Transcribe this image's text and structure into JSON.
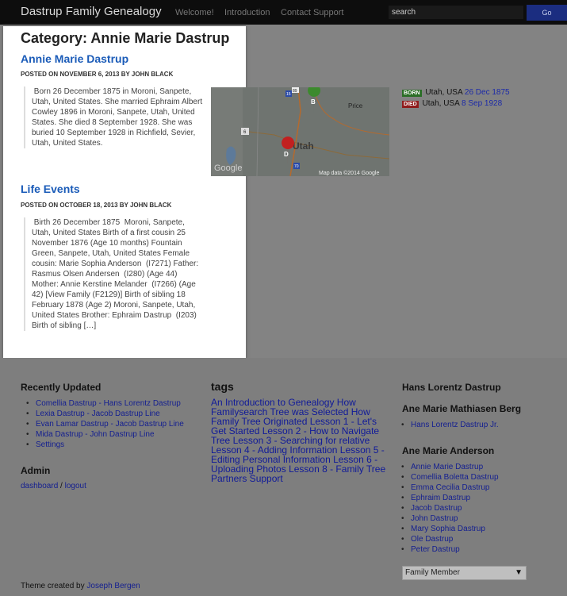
{
  "header": {
    "site_title": "Dastrup Family Genealogy",
    "nav": [
      "Welcome!",
      "Introduction",
      "Contact Support"
    ],
    "search_placeholder": "search",
    "go_label": "Go"
  },
  "main": {
    "category_title": "Category: Annie Marie Dastrup",
    "posts": [
      {
        "title": "Annie Marie Dastrup",
        "meta": "POSTED ON NOVEMBER 6, 2013 BY JOHN BLACK",
        "body": " Born 26 December 1875 in Moroni, Sanpete, Utah, United States. She married Ephraim Albert Cowley 1896 in Moroni, Sanpete, Utah, United States. She died 8 September 1928. She was buried 10 September 1928 in Richfield, Sevier, Utah, United States."
      },
      {
        "title": "Life Events",
        "meta": "POSTED ON OCTOBER 18, 2013 BY JOHN BLACK",
        "body": " Birth 26 December 1875  Moroni, Sanpete, Utah, United States Birth of a first cousin 25 November 1876 (Age 10 months) Fountain Green, Sanpete, Utah, United States Female cousin: Marie Sophia Anderson  (I7271) Father: Rasmus Olsen Andersen  (I280) (Age 44) Mother: Annie Kerstine Melander  (I7266) (Age 42) [View Family (F2129)] Birth of sibling 18 February 1878 (Age 2) Moroni, Sanpete, Utah, United States Brother: Ephraim Dastrup  (I203) Birth of sibling […]"
      }
    ],
    "map": {
      "labels": {
        "marker_b": "B",
        "marker_d": "D",
        "price": "Price",
        "utah": "Utah",
        "google": "Google",
        "attribution": "Map data ©2014 Google",
        "shield_15": "15",
        "shield_89": "89",
        "shield_6": "6",
        "shield_70": "70"
      },
      "colors": {
        "land": "#6f7470",
        "water": "#5d7a9a",
        "marker_b": "#3c8a2d",
        "marker_d": "#c22020",
        "road": "#b46a2e"
      }
    },
    "events": [
      {
        "tag": "BORN",
        "tag_color": "#2a6e26",
        "place": "Utah, USA",
        "date": "26 Dec 1875"
      },
      {
        "tag": "DIED",
        "tag_color": "#8f1c1c",
        "place": "Utah, USA",
        "date": "8 Sep 1928"
      }
    ]
  },
  "footer": {
    "recent_heading": "Recently Updated",
    "recent_items": [
      "Comellia Dastrup - Hans Lorentz Dastrup",
      "Lexia Dastrup - Jacob Dastrup Line",
      "Evan Lamar Dastrup - Jacob Dastrup Line",
      "Mida Dastrup - John Dastrup Line",
      "Settings"
    ],
    "admin_heading": "Admin",
    "admin_dashboard": "dashboard",
    "admin_sep": "/",
    "admin_logout": "logout",
    "tags_heading": "tags",
    "tags_text": "An Introduction to Genealogy How Familysearch Tree was Selected How Family Tree Originated Lesson 1 - Let's Get Started Lesson 2 - How to Navigate Tree Lesson 3 - Searching for relative Lesson 4 - Adding Information Lesson 5 - Editing Personal Information Lesson 6 - Uploading Photos Lesson 8 - Family Tree Partners Support",
    "family_heading_1": "Hans Lorentz Dastrup",
    "family_heading_2": "Ane Marie Mathiasen Berg",
    "family_items_2": [
      "Hans Lorentz Dastrup Jr."
    ],
    "family_heading_3": "Ane Marie Anderson",
    "family_items_3": [
      "Annie Marie Dastrup",
      "Comellia Boletta Dastrup",
      "Emma Cecilia Dastrup",
      "Ephraim Dastrup",
      "Jacob Dastrup",
      "John Dastrup",
      "Mary Sophia Dastrup",
      "Ole Dastrup",
      "Peter Dastrup"
    ],
    "select_value": "Family Member",
    "credit_text": "Theme created by",
    "credit_link": "Joseph Bergen"
  }
}
